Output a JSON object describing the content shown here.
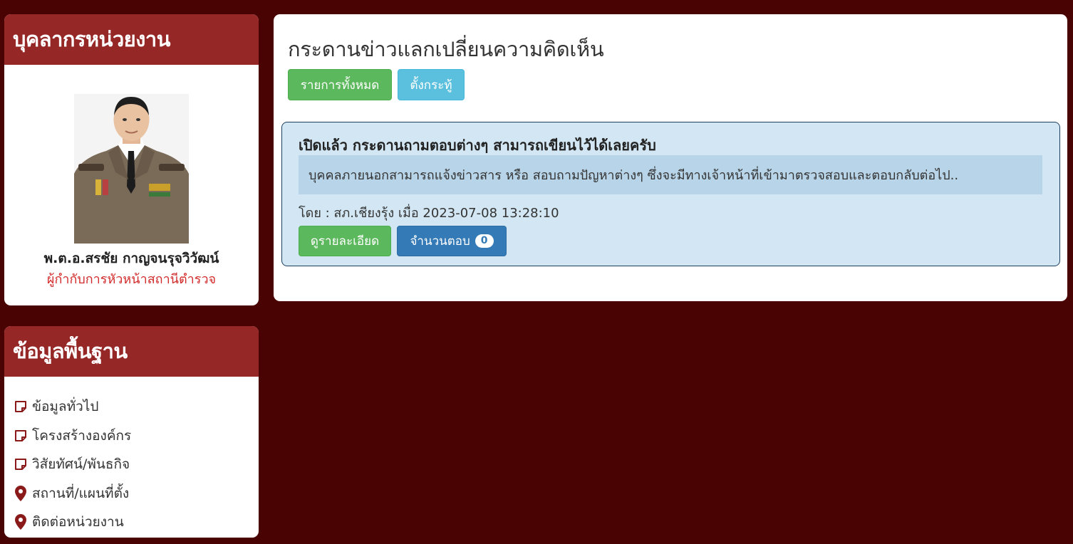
{
  "staff_panel": {
    "title": "บุคลากรหน่วยงาน",
    "name": "พ.ต.อ.สรชัย กาญจนรุจวิวัฒน์",
    "position": "ผู้กำกับการหัวหน้าสถานีตำรวจ"
  },
  "basic_panel": {
    "title": "ข้อมูลพื้นฐาน",
    "items": [
      {
        "label": "ข้อมูลทั่วไป",
        "icon": "note-icon"
      },
      {
        "label": "โครงสร้างองค์กร",
        "icon": "note-icon"
      },
      {
        "label": "วิสัยทัศน์/พันธกิจ",
        "icon": "note-icon"
      },
      {
        "label": "สถานที่/แผนที่ตั้ง",
        "icon": "map-marker-icon"
      },
      {
        "label": "ติดต่อหน่วยงาน",
        "icon": "map-marker-icon"
      }
    ]
  },
  "board": {
    "title": "กระดานข่าวแลกเปลี่ยนความคิดเห็น",
    "all_button": "รายการทั้งหมด",
    "new_button": "ตั้งกระทู้",
    "post": {
      "title": "เปิดแล้ว กระดานถามตอบต่างๆ สามารถเขียนไว้ได้เลยครับ",
      "body": "บุคคลภายนอกสามารถแจ้งข่าวสาร หรือ สอบถามปัญหาต่างๆ ซึ่งจะมีทางเจ้าหน้าที่เข้ามาตรวจสอบและตอบกลับต่อไป..",
      "meta": "โดย : สภ.เชียงรุ้ง เมื่อ 2023-07-08 13:28:10",
      "detail_button": "ดูรายละเอียด",
      "reply_label": "จำนวนตอบ",
      "reply_count": "0"
    }
  },
  "colors": {
    "background": "#4a0303",
    "panel_header": "#962727",
    "accent_icon": "#8a1a1a",
    "position_text": "#d22b2b"
  }
}
